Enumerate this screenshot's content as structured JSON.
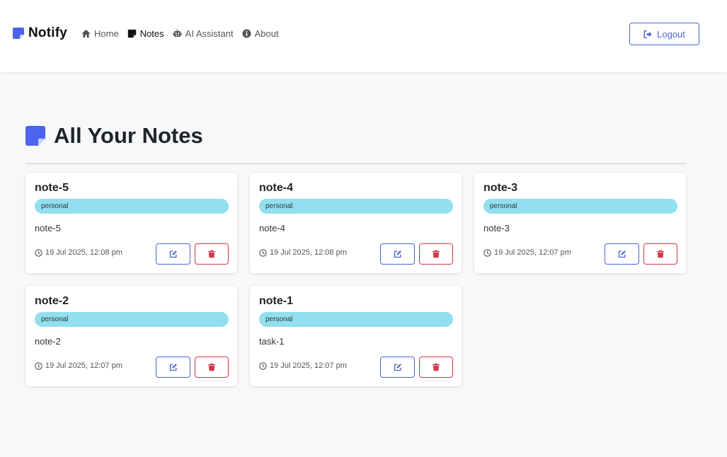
{
  "brand": {
    "name": "Notify",
    "color": "#4c63f0"
  },
  "nav": {
    "items": [
      {
        "label": "Home",
        "icon": "home-icon",
        "active": false
      },
      {
        "label": "Notes",
        "icon": "note-icon",
        "active": true
      },
      {
        "label": "AI Assistant",
        "icon": "robot-icon",
        "active": false
      },
      {
        "label": "About",
        "icon": "info-icon",
        "active": false
      }
    ],
    "logout_label": "Logout"
  },
  "page": {
    "title": "All Your Notes"
  },
  "colors": {
    "accent": "#4c63d2",
    "danger": "#d0374a",
    "tag": "#91dff0"
  },
  "notes": [
    {
      "title": "note-5",
      "tag": "personal",
      "body": "note-5",
      "timestamp": "19 Jul 2025, 12:08 pm"
    },
    {
      "title": "note-4",
      "tag": "personal",
      "body": "note-4",
      "timestamp": "19 Jul 2025, 12:08 pm"
    },
    {
      "title": "note-3",
      "tag": "personal",
      "body": "note-3",
      "timestamp": "19 Jul 2025, 12:07 pm"
    },
    {
      "title": "note-2",
      "tag": "personal",
      "body": "note-2",
      "timestamp": "19 Jul 2025, 12:07 pm"
    },
    {
      "title": "note-1",
      "tag": "personal",
      "body": "task-1",
      "timestamp": "19 Jul 2025, 12:07 pm"
    }
  ]
}
